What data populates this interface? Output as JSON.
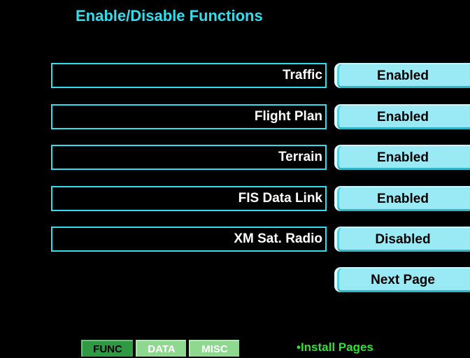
{
  "page": {
    "title": "Enable/Disable Functions"
  },
  "functions": [
    {
      "label": "Traffic",
      "state": "Enabled"
    },
    {
      "label": "Flight Plan",
      "state": "Enabled"
    },
    {
      "label": "Terrain",
      "state": "Enabled"
    },
    {
      "label": "FIS Data Link",
      "state": "Enabled"
    },
    {
      "label": "XM Sat. Radio",
      "state": "Disabled"
    }
  ],
  "next_page_label": "Next Page",
  "tabs": [
    {
      "label": "FUNC",
      "active": true
    },
    {
      "label": "DATA",
      "active": false
    },
    {
      "label": "MISC",
      "active": false
    }
  ],
  "install_pages_label": "•Install Pages",
  "colors": {
    "background": "#000000",
    "title": "#33ddee",
    "label_border": "#33ddee",
    "label_text": "#ffffff",
    "softkey_fill": "#99eaf5",
    "tab_active": "#2f9944",
    "tab_inactive": "#8fd88f",
    "install_text": "#33e033"
  }
}
